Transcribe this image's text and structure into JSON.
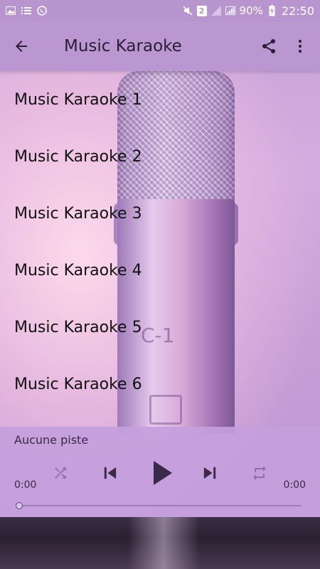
{
  "status_bar": {
    "battery": "90%",
    "time": "22:50",
    "sim": "2"
  },
  "app_bar": {
    "title": "Music Karaoke"
  },
  "tracks": [
    {
      "label": "Music Karaoke 1"
    },
    {
      "label": "Music Karaoke 2"
    },
    {
      "label": "Music Karaoke 3"
    },
    {
      "label": "Music Karaoke 4"
    },
    {
      "label": "Music Karaoke 5"
    },
    {
      "label": "Music Karaoke 6"
    }
  ],
  "player": {
    "track_name": "Aucune piste",
    "elapsed": "0:00",
    "duration": "0:00",
    "progress": 0
  },
  "colors": {
    "app_bar": "#ba97d1",
    "status_bar": "#b895cf",
    "player": "#c4a0dc"
  }
}
